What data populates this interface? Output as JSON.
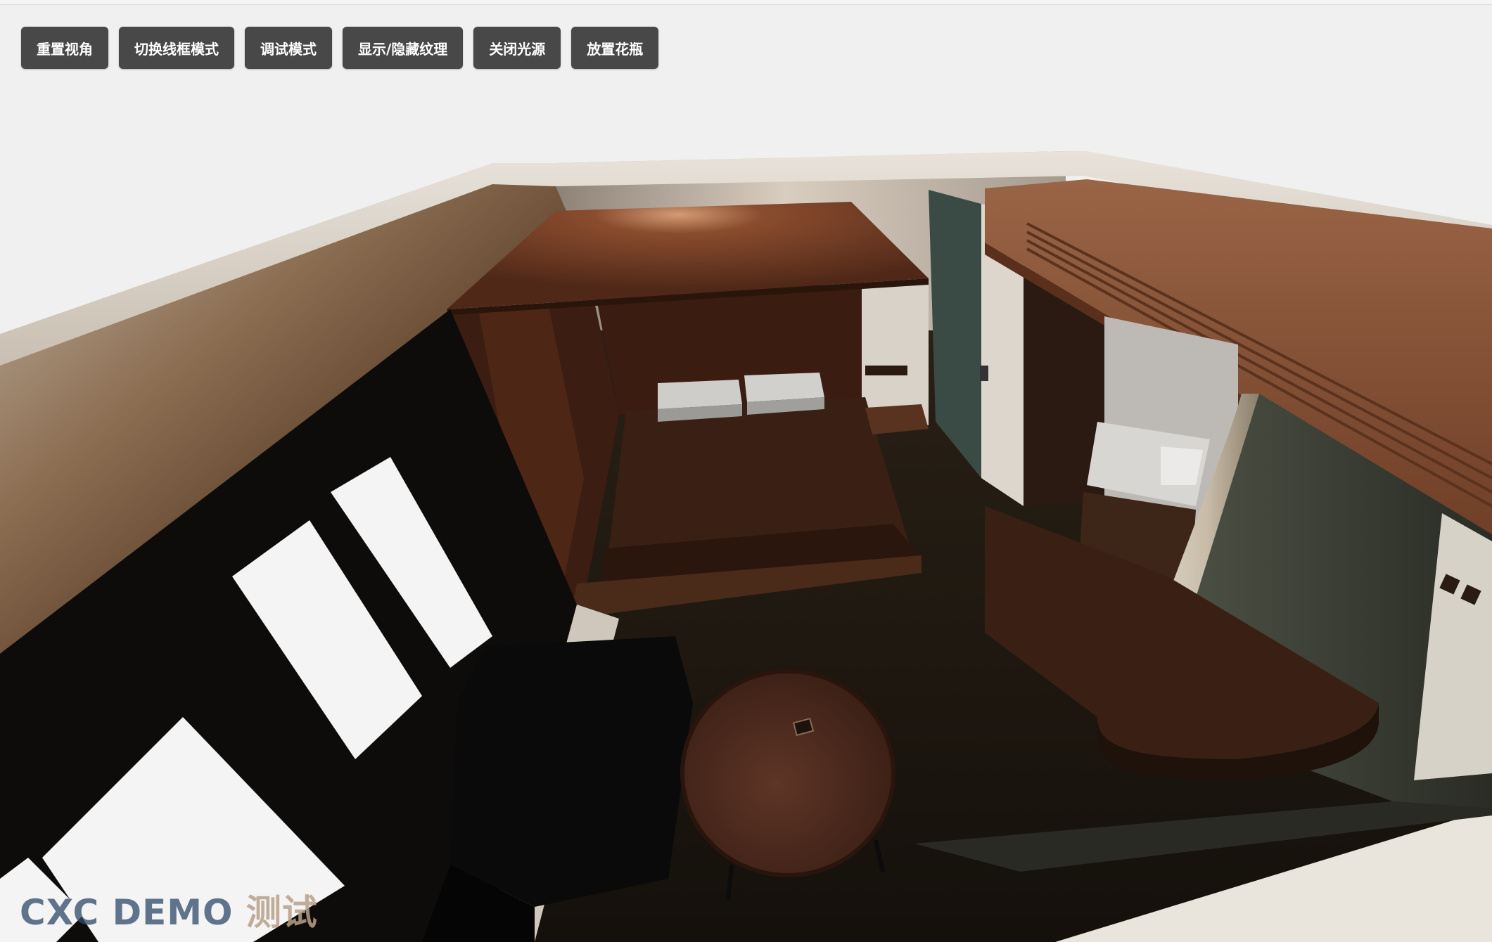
{
  "toolbar": {
    "buttons": [
      {
        "id": "reset-view",
        "label": "重置视角"
      },
      {
        "id": "wireframe",
        "label": "切换线框模式"
      },
      {
        "id": "debug",
        "label": "调试模式"
      },
      {
        "id": "texture",
        "label": "显示/隐藏纹理"
      },
      {
        "id": "light",
        "label": "关闭光源"
      },
      {
        "id": "vase",
        "label": "放置花瓶"
      }
    ]
  },
  "watermark": {
    "part1": "CXC DEMO",
    "part2": "测试"
  },
  "colors": {
    "page_bg": "#f0f0f0",
    "button_bg": "#484848",
    "button_text": "#ffffff",
    "wood": "#6a3a24",
    "floor": "#1c160f",
    "wall": "#d9d0c4"
  }
}
